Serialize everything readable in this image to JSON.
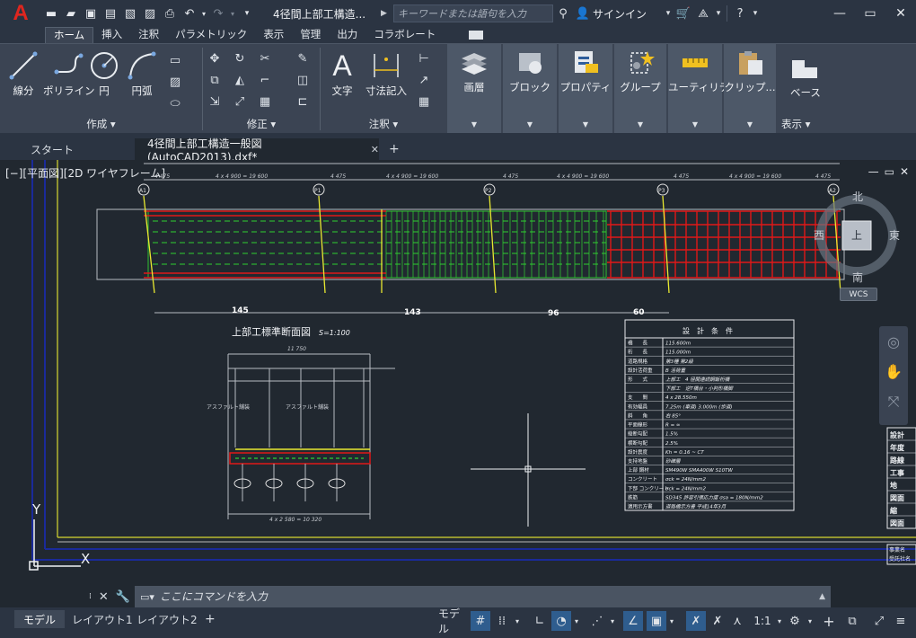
{
  "titlebar": {
    "logo": "A",
    "document_title": "4径間上部工構造...",
    "search_placeholder": "キーワードまたは語句を入力",
    "signin": "サインイン"
  },
  "ribbon_tabs": [
    "ホーム",
    "挿入",
    "注釈",
    "パラメトリック",
    "表示",
    "管理",
    "出力",
    "コラボレート"
  ],
  "panels": {
    "draw": {
      "title": "作成 ▾",
      "tools": [
        "線分",
        "ポリライン",
        "円",
        "円弧"
      ]
    },
    "modify": {
      "title": "修正 ▾"
    },
    "annotation": {
      "title": "注釈 ▾",
      "tools": [
        "文字",
        "寸法記入"
      ]
    },
    "groups": [
      "画層",
      "ブロック",
      "プロパティ",
      "グループ",
      "ユーティリティ",
      "クリップ..."
    ],
    "view": {
      "base_label": "ベース",
      "title": "表示 ▾"
    }
  },
  "file_tabs": {
    "start": "スタート",
    "active": "4径間上部工構造一般図(AutoCAD2013).dxf*"
  },
  "viewport": {
    "label": "[−][平面図][2D ワイヤフレーム]"
  },
  "drawing": {
    "section_title": "上部工標準断面図",
    "section_scale": "S=1:100",
    "dims_top": [
      "4 475",
      "4 x 4 900 = 19 600",
      "4 475",
      "4 x 4 900 = 19 600",
      "4 475",
      "4 x 4 900 = 19 600",
      "4 475",
      "4 x 4 900 = 19 600",
      "4 475"
    ],
    "bottom_dims": [
      "145",
      "143",
      "96",
      "60"
    ],
    "piers": [
      "A1",
      "P1",
      "P2",
      "P3",
      "A2"
    ],
    "section_overall": "11 750",
    "section_bottom": "4 x 2 580 = 10 320",
    "section_labels": [
      "アスファルト舗装",
      "アスファルト舗装"
    ],
    "design_title": "設　計　条　件",
    "design_rows": [
      [
        "橋　　長",
        "115.600m"
      ],
      [
        "桁　　長",
        "115.000m"
      ],
      [
        "道路規格",
        "第3種 第2級"
      ],
      [
        "設計活荷重",
        "B 活荷重"
      ],
      [
        "形　　式",
        "上部工　4 径間連続鋼鈑桁橋"
      ],
      [
        "",
        "下部工　逆T橋台・小判形橋脚"
      ],
      [
        "支　　間",
        "4 x 28.550m"
      ],
      [
        "有効幅員",
        "7.25m (車道) 3.000m (歩道)"
      ],
      [
        "斜　　角",
        "右 85°"
      ],
      [
        "平面線形",
        "R = ∞"
      ],
      [
        "縦断勾配",
        "1.5%"
      ],
      [
        "横断勾配",
        "2.5%"
      ],
      [
        "設計震度",
        "Kh = 0.16 ~ CT"
      ],
      [
        "支持地盤",
        "砂礫層"
      ],
      [
        "上部 鋼材",
        "SM490W  SMA400W  S10TW"
      ],
      [
        "コンクリート",
        "σck = 24N/mm2"
      ],
      [
        "下部 コンクリート",
        "σck = 24N/mm2"
      ],
      [
        "鉄筋",
        "SD345  許容引張応力度 σsa = 180N/mm2"
      ],
      [
        "適用示方書",
        "道路橋示方書  平成14年3月"
      ]
    ],
    "right_table": [
      "設計",
      "年度",
      "路線",
      "工事",
      "地",
      "図面",
      "縮",
      "図面"
    ],
    "bottom_right": [
      "事業名",
      "受託社名"
    ]
  },
  "viewcube": {
    "north": "北",
    "south": "南",
    "east": "東",
    "west": "西",
    "center": "上",
    "wcs": "WCS"
  },
  "commandline": {
    "placeholder": "ここにコマンドを入力"
  },
  "layout_tabs": [
    "モデル",
    "レイアウト1",
    "レイアウト2"
  ],
  "statusbar": {
    "model_label": "モデル",
    "scale": "1:1"
  }
}
